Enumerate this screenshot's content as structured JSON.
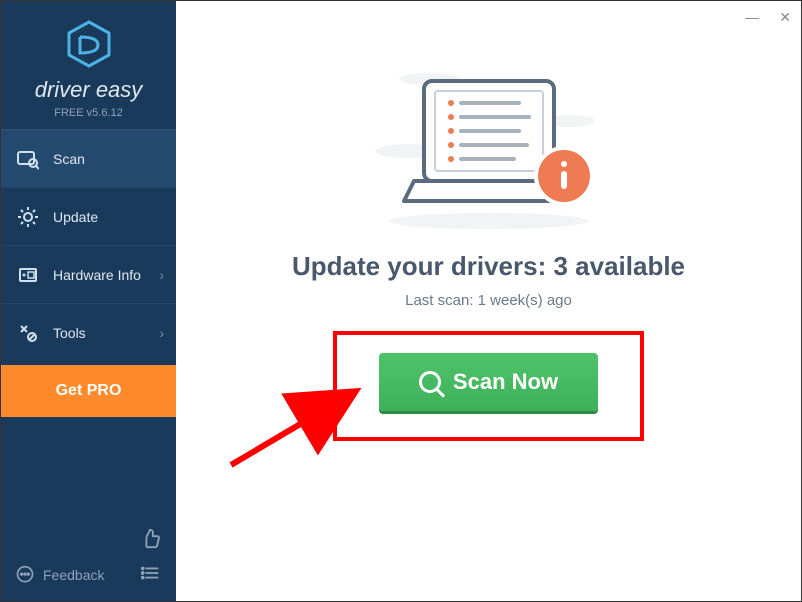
{
  "brand": {
    "name": "driver easy",
    "version": "FREE v5.6.12"
  },
  "sidebar": {
    "items": [
      {
        "label": "Scan",
        "hasChevron": false
      },
      {
        "label": "Update",
        "hasChevron": false
      },
      {
        "label": "Hardware Info",
        "hasChevron": true
      },
      {
        "label": "Tools",
        "hasChevron": true
      }
    ],
    "getpro": "Get PRO",
    "feedback": "Feedback"
  },
  "main": {
    "headline_prefix": "Update your drivers: ",
    "headline_count": "3 available",
    "subline": "Last scan: 1 week(s) ago",
    "scan_button": "Scan Now"
  },
  "colors": {
    "sidebar_bg": "#1a3a5c",
    "accent_orange": "#ff8a2b",
    "scan_green": "#4fc36a",
    "highlight_red": "#ff0000"
  }
}
